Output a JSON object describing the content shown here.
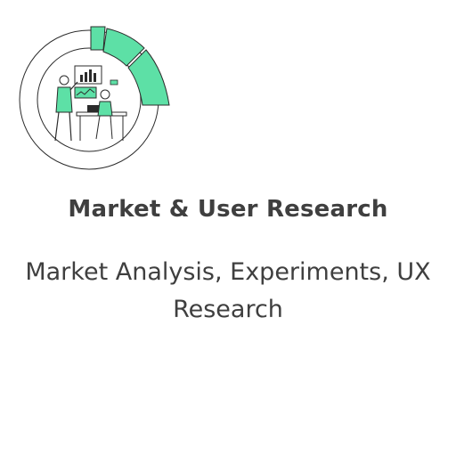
{
  "card": {
    "title": "Market & User Research",
    "subtitle": "Market Analysis, Experiments, UX Research",
    "illustration_icon": "research-illustration-icon"
  },
  "colors": {
    "accent": "#5de0a6",
    "text": "#3f3f3f",
    "line": "#2b2b2b",
    "background": "#ffffff"
  }
}
